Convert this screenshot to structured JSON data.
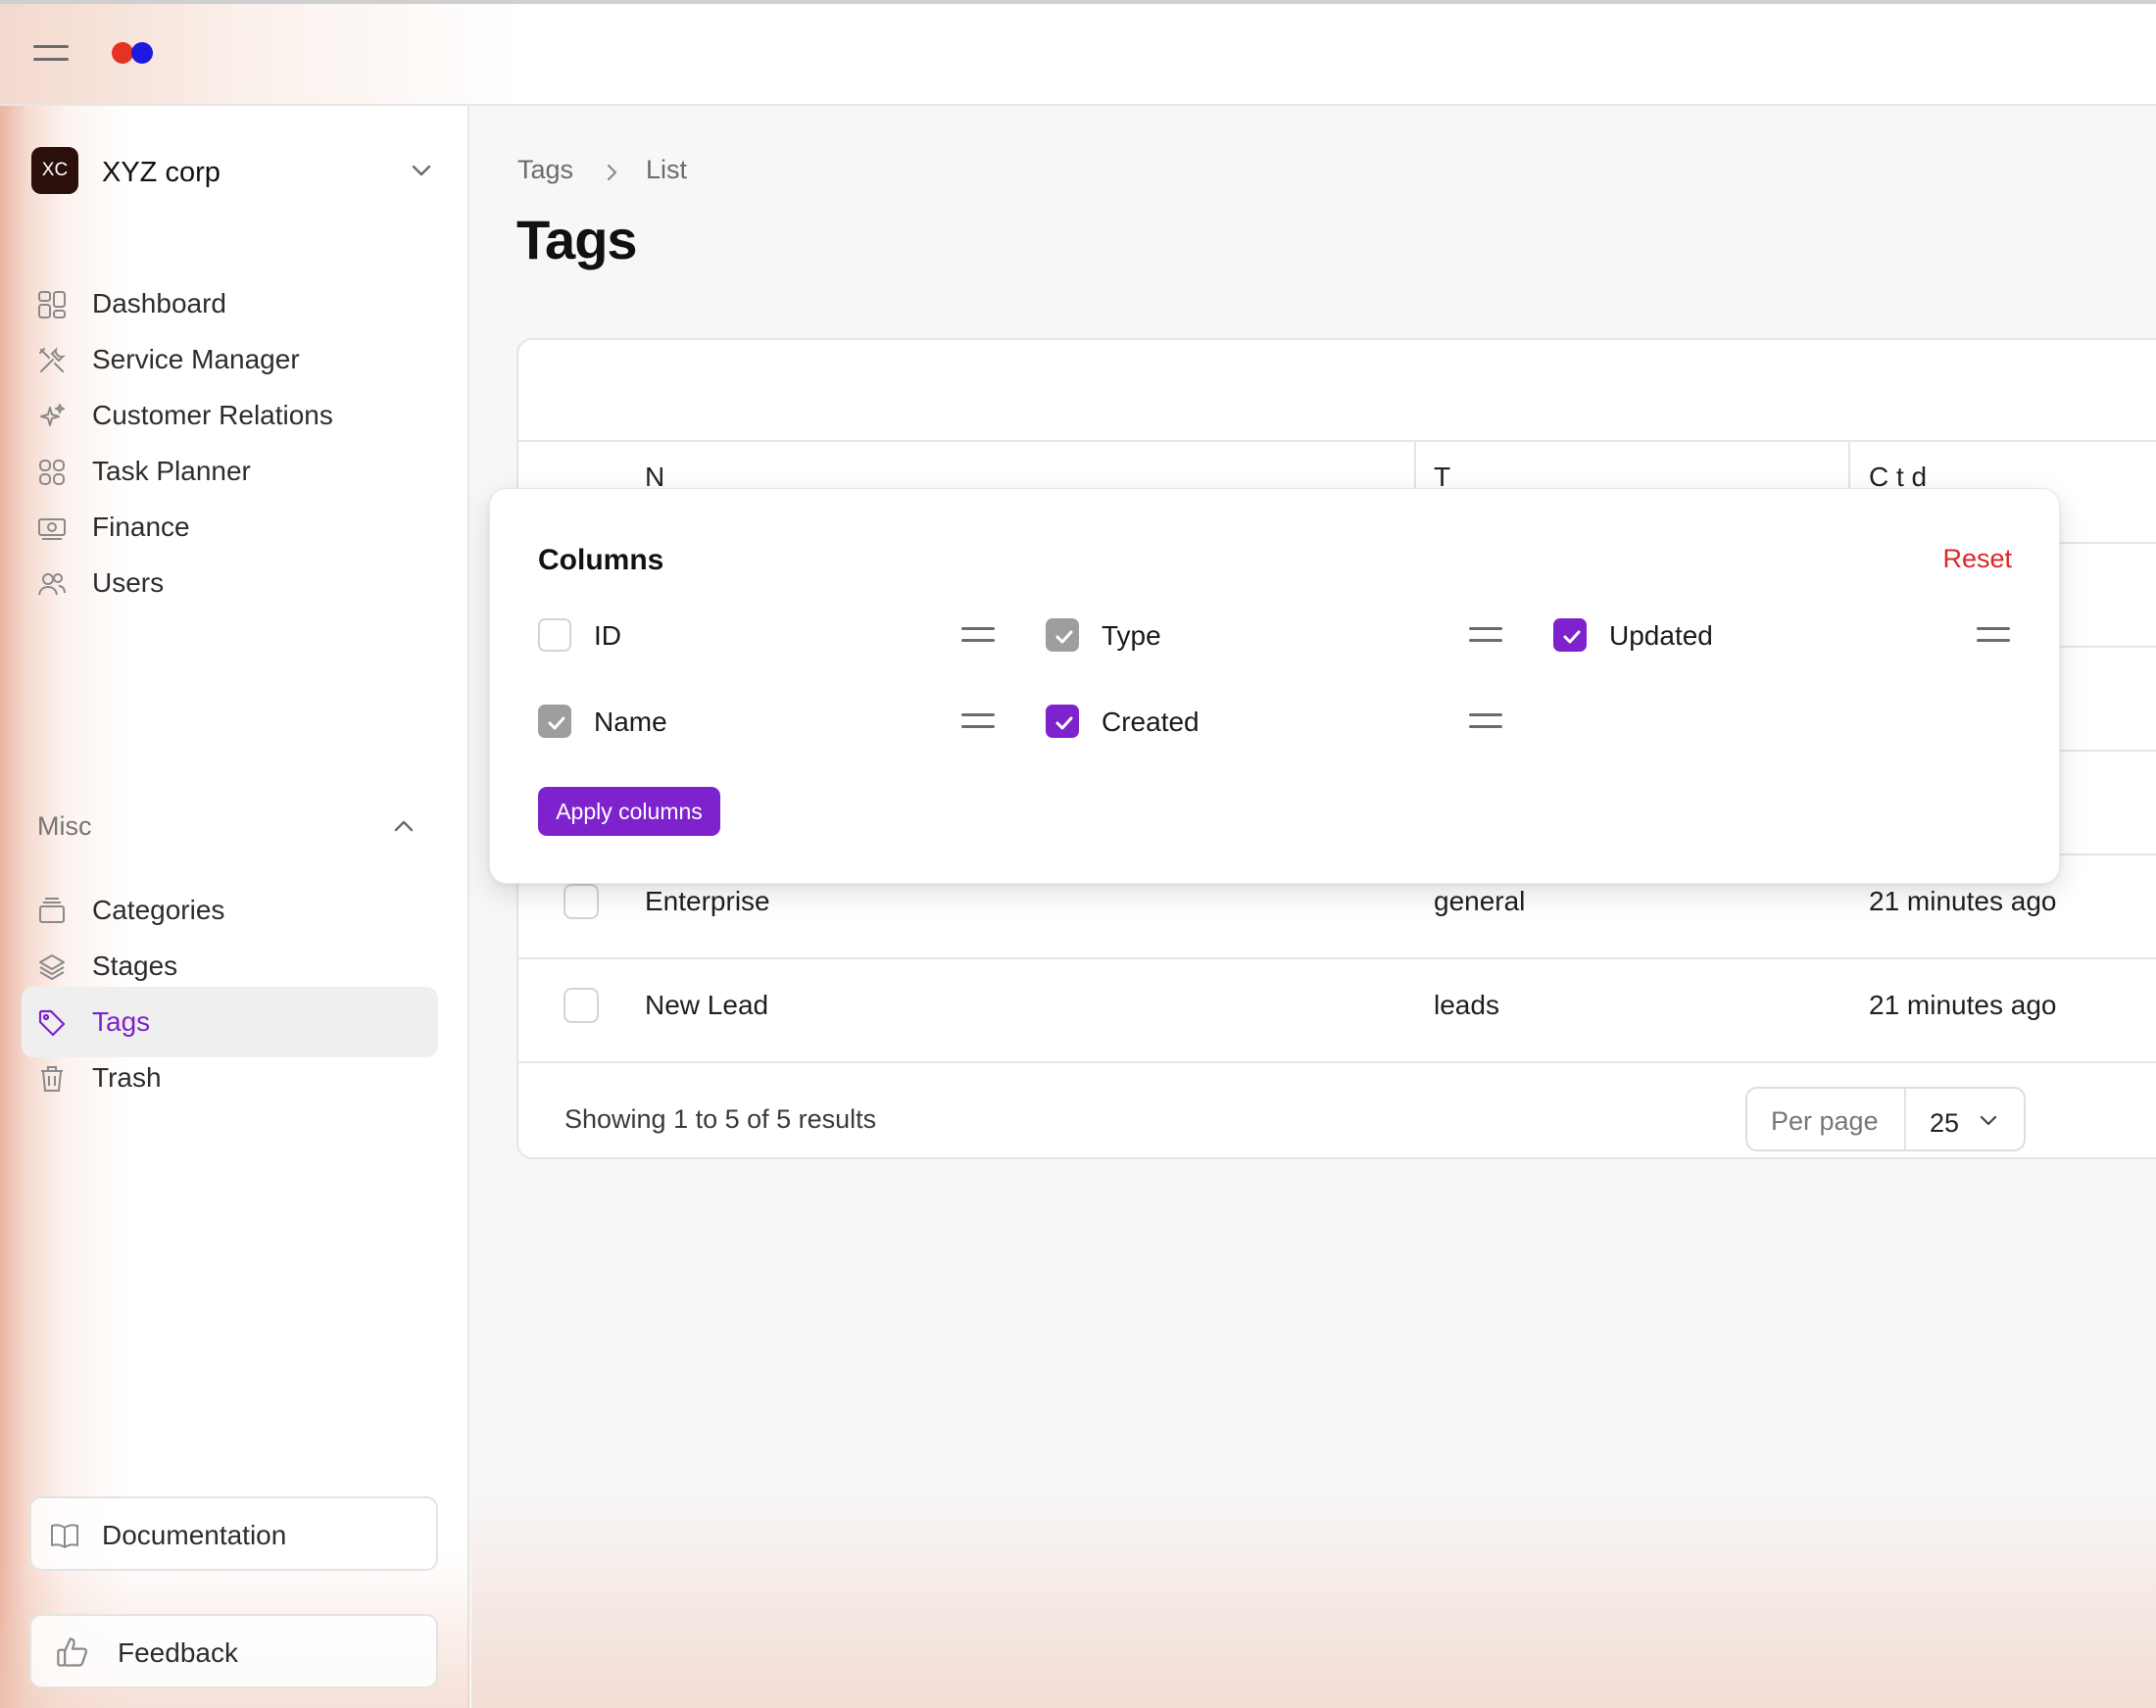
{
  "colors": {
    "accent": "#7e22ce",
    "reset": "#dc2626",
    "logo_dot_1": "#e53222",
    "logo_dot_2": "#1a1ae0"
  },
  "org": {
    "initials": "XC",
    "name": "XYZ corp"
  },
  "sidebar": {
    "items": [
      {
        "label": "Dashboard",
        "icon": "dashboard-icon"
      },
      {
        "label": "Service Manager",
        "icon": "tools-icon"
      },
      {
        "label": "Customer Relations",
        "icon": "sparkles-icon"
      },
      {
        "label": "Task Planner",
        "icon": "grid-icon"
      },
      {
        "label": "Finance",
        "icon": "banknote-icon"
      },
      {
        "label": "Users",
        "icon": "users-icon"
      }
    ],
    "misc_label": "Misc",
    "misc_items": [
      {
        "label": "Categories",
        "icon": "archive-icon"
      },
      {
        "label": "Stages",
        "icon": "layers-icon"
      },
      {
        "label": "Tags",
        "icon": "tag-icon",
        "active": true
      },
      {
        "label": "Trash",
        "icon": "trash-icon"
      }
    ],
    "documentation_label": "Documentation",
    "feedback_label": "Feedback"
  },
  "breadcrumb": {
    "root": "Tags",
    "current": "List"
  },
  "page_title": "Tags",
  "table": {
    "header_peek": [
      "N",
      "T",
      "C   t  d"
    ],
    "rows": [
      {
        "name": "Enterprise",
        "type": "general",
        "created": "21 minutes ago"
      },
      {
        "name": "New Lead",
        "type": "leads",
        "created": "21 minutes ago"
      }
    ],
    "footer_text": "Showing 1 to 5 of 5 results",
    "per_page_label": "Per page",
    "per_page_value": "25"
  },
  "columns_popover": {
    "title": "Columns",
    "reset_label": "Reset",
    "options": [
      {
        "label": "ID",
        "checked": false
      },
      {
        "label": "Type",
        "checked": true,
        "disabled": true
      },
      {
        "label": "Updated",
        "checked": true
      },
      {
        "label": "Name",
        "checked": true,
        "disabled": true
      },
      {
        "label": "Created",
        "checked": true
      }
    ],
    "apply_label": "Apply columns"
  }
}
